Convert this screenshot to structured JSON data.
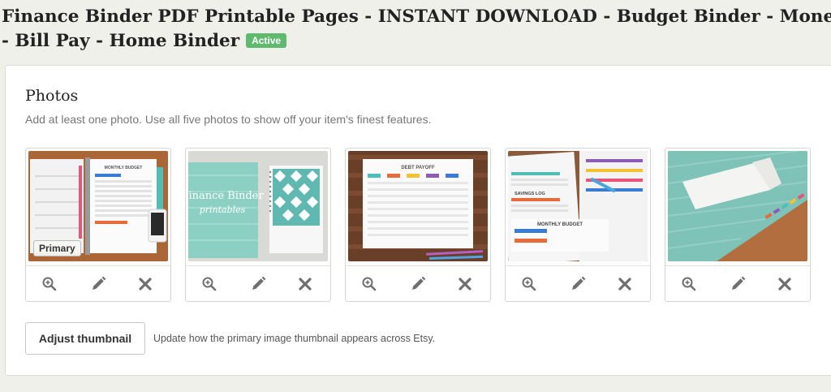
{
  "listing": {
    "title_line1": "Finance Binder PDF Printable Pages - INSTANT DOWNLOAD - Budget Binder - Money Manag",
    "title_line2": "- Bill Pay - Home Binder",
    "status_badge": "Active"
  },
  "photos_section": {
    "title": "Photos",
    "description": "Add at least one photo. Use all five photos to show off your item's finest features.",
    "primary_label": "Primary",
    "photos": [
      {
        "id": "monthly-budget-binder"
      },
      {
        "id": "finance-binder-cover"
      },
      {
        "id": "debt-payoff-sheet"
      },
      {
        "id": "monthly-budget-pages"
      },
      {
        "id": "envelope-binder"
      }
    ],
    "thumb_text": {
      "monthly_budget": "MONTHLY BUDGET",
      "finance_binder": "Finance Binder",
      "printables": "printables",
      "debt_payoff": "DEBT PAYOFF",
      "savings_log": "SAVINGS LOG",
      "monthly_budget_2": "MONTHLY BUDGET"
    }
  },
  "thumbnail": {
    "button_label": "Adjust thumbnail",
    "description": "Update how the primary image thumbnail appears across Etsy."
  },
  "icons": {
    "zoom": "zoom-in-icon",
    "edit": "pencil-icon",
    "delete": "close-icon"
  },
  "colors": {
    "badge": "#5fb96f",
    "icon": "#6f6f6f"
  }
}
